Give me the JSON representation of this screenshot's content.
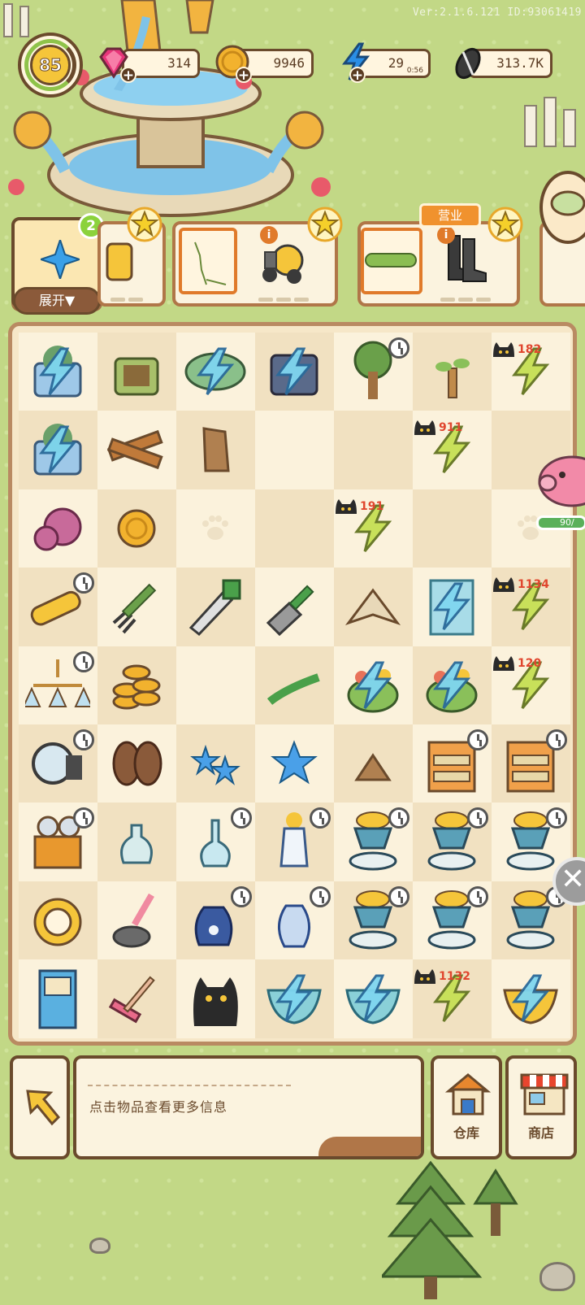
{
  "version_text": "Ver:2.1.6.121 ID:93061419",
  "player": {
    "level": "85"
  },
  "resources": [
    {
      "name": "gems",
      "icon": "gem-icon",
      "value": "314",
      "color": "#e8357a"
    },
    {
      "name": "coins",
      "icon": "coin-icon",
      "value": "9946",
      "color": "#f2b22e"
    },
    {
      "name": "energy",
      "icon": "lightning-icon",
      "value": "29",
      "timer": "0:56",
      "color": "#2a8ee6"
    },
    {
      "name": "seeds",
      "icon": "sunflower-seed-icon",
      "value": "313.7K",
      "color": "#4a4a4a"
    }
  ],
  "orders": {
    "expand_label": "展开▼",
    "notification_count": "2",
    "business_tab": "营业"
  },
  "board": {
    "columns": 7,
    "rows": 9,
    "cells": [
      [
        "planter-box-energy",
        "seed-box",
        "green-wing-energy",
        "dark-machine-energy",
        "tree-clock",
        "sapling",
        "cat-energy-182"
      ],
      [
        "planter-box-energy",
        "wood-planks",
        "tree-stump",
        "",
        "",
        "cat-energy-911",
        ""
      ],
      [
        "yarn-ball",
        "gold-coin",
        "",
        "",
        "cat-energy-191",
        "",
        ""
      ],
      [
        "flashlight-clock",
        "garden-fork",
        "hand-saw",
        "trowel",
        "moth",
        "cabinet-energy",
        "cat-energy-1134"
      ],
      [
        "chandelier-clock",
        "coin-stack",
        "",
        "pruning-knife",
        "basket-energy",
        "basket-energy",
        "cat-energy-120"
      ],
      [
        "spotlight-clock",
        "paw-slippers",
        "blue-stars",
        "blue-star",
        "broken-pot",
        "drawer-shelf-clock",
        "drawer-shelf-clock"
      ],
      [
        "projector-clock",
        "vase-plant",
        "glass-vase-clock",
        "tall-flower-vase-clock",
        "teacup-tower-clock",
        "teacup-tower-clock",
        "teacup-tower-clock"
      ],
      [
        "gold-compass",
        "toilet-plunger",
        "blue-jug-clock",
        "blue-vase-clock",
        "teacup-tower-clock",
        "teacup-tower-clock",
        "teacup-tower-clock"
      ],
      [
        "arcade-machine",
        "squeegee",
        "black-cat",
        "teal-bowl-energy",
        "teal-bowl-energy",
        "cat-energy-1132",
        "golden-bowl-energy"
      ]
    ],
    "cat_counts": {
      "182": "182",
      "911": "911",
      "191": "191",
      "1134": "1134",
      "120": "120",
      "1132": "1132"
    }
  },
  "side": {
    "piggy_bank_progress": "90/"
  },
  "bottom": {
    "info_text": "点击物品查看更多信息",
    "warehouse_label": "仓库",
    "shop_label": "商店"
  }
}
